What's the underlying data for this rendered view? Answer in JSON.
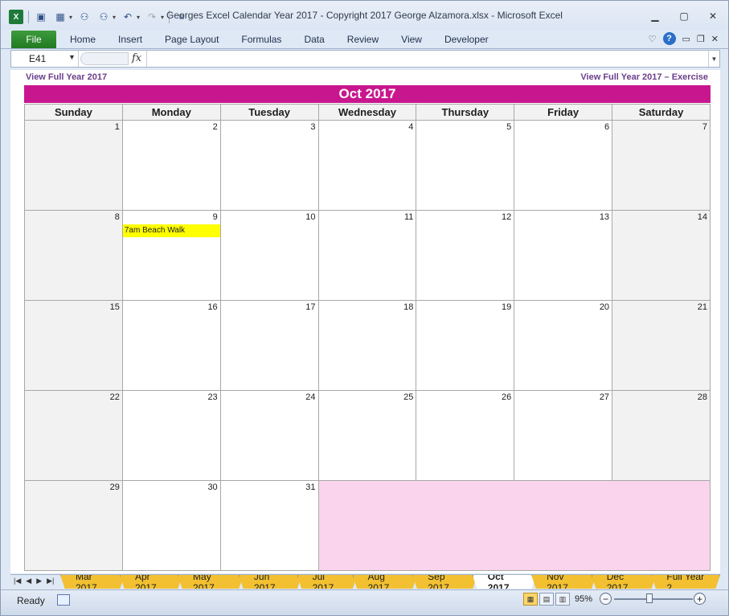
{
  "window": {
    "title": "Georges Excel Calendar Year 2017  -  Copyright 2017 George Alzamora.xlsx  -  Microsoft Excel"
  },
  "ribbon": {
    "file_label": "File",
    "tabs": [
      "Home",
      "Insert",
      "Page Layout",
      "Formulas",
      "Data",
      "Review",
      "View",
      "Developer"
    ]
  },
  "formula_bar": {
    "name_box": "E41",
    "fx_label": "fx",
    "value": ""
  },
  "sheet": {
    "link_left": "View Full Year 2017",
    "link_right": "View Full Year 2017 – Exercise",
    "month_title": "Oct 2017",
    "accent_color": "#c8178e",
    "filler_color": "#fad4ec",
    "event_color": "#ffff00",
    "weekdays": [
      "Sunday",
      "Monday",
      "Tuesday",
      "Wednesday",
      "Thursday",
      "Friday",
      "Saturday"
    ],
    "weeks": [
      [
        "1",
        "2",
        "3",
        "4",
        "5",
        "6",
        "7"
      ],
      [
        "8",
        "9",
        "10",
        "11",
        "12",
        "13",
        "14"
      ],
      [
        "15",
        "16",
        "17",
        "18",
        "19",
        "20",
        "21"
      ],
      [
        "22",
        "23",
        "24",
        "25",
        "26",
        "27",
        "28"
      ],
      [
        "29",
        "30",
        "31",
        "",
        "",
        "",
        ""
      ]
    ],
    "events": [
      {
        "day": "9",
        "text": "7am Beach Walk"
      }
    ]
  },
  "sheet_tabs": {
    "tabs": [
      "Mar 2017",
      "Apr 2017",
      "May 2017",
      "Jun 2017",
      "Jul 2017",
      "Aug 2017",
      "Sep 2017",
      "Oct 2017",
      "Nov 2017",
      "Dec 2017",
      "Full Year 2"
    ],
    "active": "Oct 2017",
    "tab_color": "#f2c030"
  },
  "status_bar": {
    "ready": "Ready",
    "zoom": "95%"
  }
}
